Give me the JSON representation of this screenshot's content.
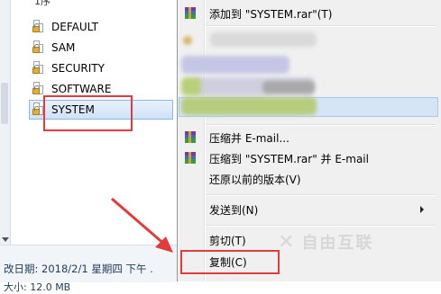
{
  "explorer": {
    "top_cut_text": "1序",
    "files": [
      {
        "name": "DEFAULT"
      },
      {
        "name": "SAM"
      },
      {
        "name": "SECURITY"
      },
      {
        "name": "SOFTWARE"
      },
      {
        "name": "SYSTEM"
      }
    ],
    "status": {
      "line1": "改日期: 2018/2/1 星期四 下午 .",
      "line2": "大小: 12.0 MB"
    }
  },
  "context_menu": {
    "add_to_archive": "添加到 \"SYSTEM.rar\"(T)",
    "compress_email": "压缩并 E-mail...",
    "compress_rar_email": "压缩到 \"SYSTEM.rar\" 并 E-mail",
    "restore_previous": "还原以前的版本(V)",
    "send_to": "发送到(N)",
    "cut": "剪切(T)",
    "copy": "复制(C)"
  },
  "watermark": "自由互联",
  "colors": {
    "selection": "#cfe2f7",
    "annotation_red": "#e23b3b",
    "menu_bg": "#f0f0f0"
  }
}
